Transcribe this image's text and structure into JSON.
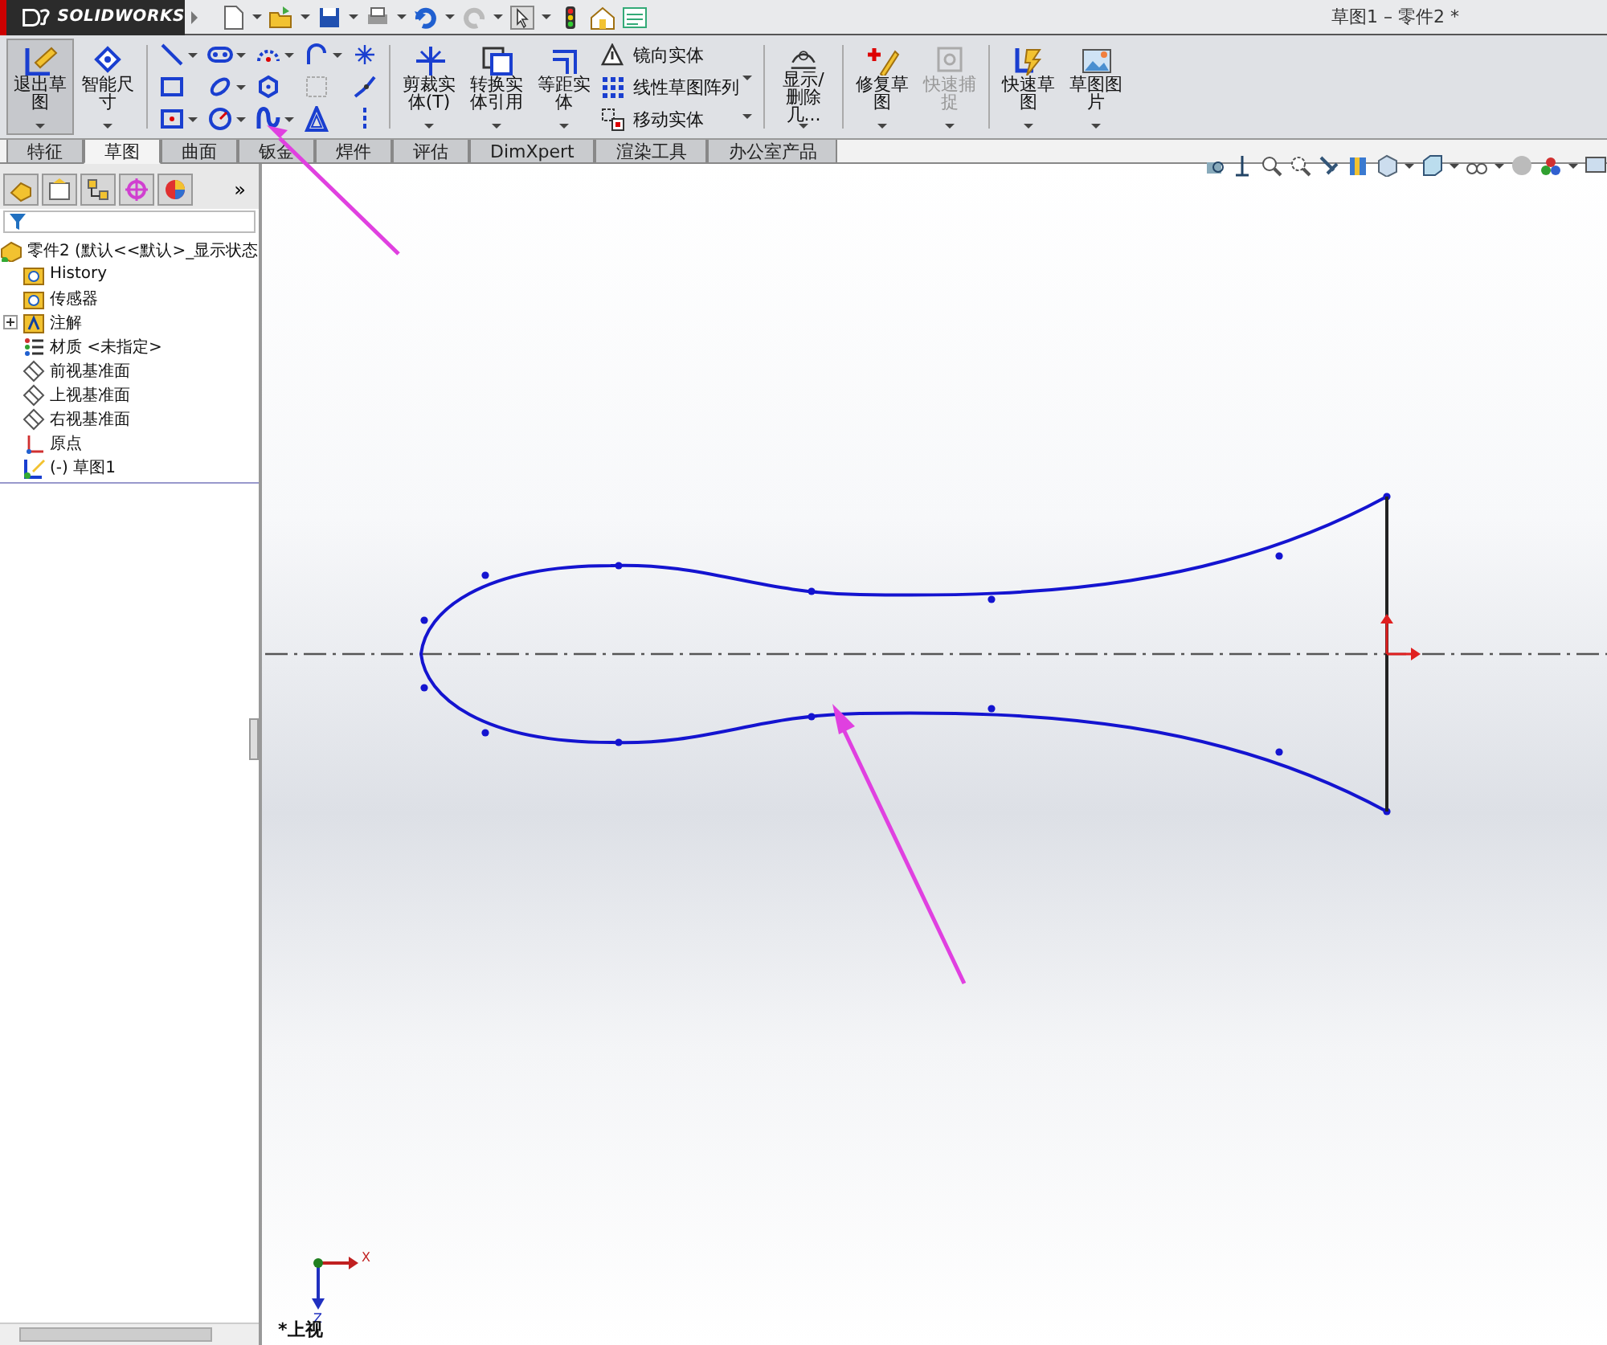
{
  "titlebar": {
    "logo": "SOLIDWORKS",
    "title": "草图1 – 零件2 *"
  },
  "ribbon": {
    "buttons": [
      {
        "kind": "big",
        "label": "退出草图",
        "selected": true,
        "disabled": false
      },
      {
        "kind": "big",
        "label": "智能尺寸",
        "selected": false,
        "disabled": false
      },
      {
        "kind": "grid"
      },
      {
        "kind": "big",
        "label": "剪裁实体(T)",
        "selected": false,
        "disabled": false
      },
      {
        "kind": "big",
        "label": "转换实体引用",
        "selected": false,
        "disabled": false
      },
      {
        "kind": "big",
        "label": "等距实体",
        "selected": false,
        "disabled": false
      },
      {
        "kind": "list",
        "items": [
          {
            "label": "镜向实体"
          },
          {
            "label": "线性草图阵列"
          },
          {
            "label": "移动实体"
          }
        ]
      },
      {
        "kind": "big",
        "label": "显示/删除几...",
        "selected": false,
        "disabled": false
      },
      {
        "kind": "big",
        "label": "修复草图",
        "selected": false,
        "disabled": false
      },
      {
        "kind": "big",
        "label": "快速捕捉",
        "selected": false,
        "disabled": true
      },
      {
        "kind": "big",
        "label": "快速草图",
        "selected": false,
        "disabled": false
      },
      {
        "kind": "big",
        "label": "草图图片",
        "selected": false,
        "disabled": false
      }
    ]
  },
  "tabs": [
    {
      "label": "特征",
      "selected": false
    },
    {
      "label": "草图",
      "selected": true
    },
    {
      "label": "曲面",
      "selected": false
    },
    {
      "label": "钣金",
      "selected": false
    },
    {
      "label": "焊件",
      "selected": false
    },
    {
      "label": "评估",
      "selected": false
    },
    {
      "label": "DimXpert",
      "selected": false
    },
    {
      "label": "渲染工具",
      "selected": false
    },
    {
      "label": "办公室产品",
      "selected": false
    }
  ],
  "panel": {
    "more": "»",
    "tree": {
      "label": "零件2 (默认<<默认>_显示状态",
      "children": [
        {
          "label": "History"
        },
        {
          "label": "传感器"
        },
        {
          "label": "注解",
          "expanded": false
        },
        {
          "label": "材质 <未指定>"
        },
        {
          "label": "前视基准面"
        },
        {
          "label": "上视基准面"
        },
        {
          "label": "右视基准面"
        },
        {
          "label": "原点"
        },
        {
          "label": "(-) 草图1"
        }
      ]
    }
  },
  "viewport": {
    "triad": {
      "x_label": "X",
      "z_label": "Z"
    },
    "view_name": "*上视"
  }
}
